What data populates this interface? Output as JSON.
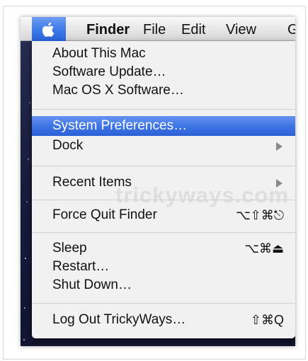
{
  "menubar": {
    "apple_icon": "apple-logo-icon",
    "items": [
      "Finder",
      "File",
      "Edit",
      "View",
      "G"
    ]
  },
  "watermark": "trickyways.com",
  "menu": {
    "groups": [
      [
        {
          "label": "About This Mac"
        },
        {
          "label": "Software Update…"
        },
        {
          "label": "Mac OS X Software…"
        }
      ],
      [
        {
          "label": "System Preferences…",
          "highlighted": true
        },
        {
          "label": "Dock",
          "submenu": true
        }
      ],
      [
        {
          "label": "Recent Items",
          "submenu": true
        }
      ],
      [
        {
          "label": "Force Quit Finder",
          "shortcut": "⌥⇧⌘⎋"
        }
      ],
      [
        {
          "label": "Sleep",
          "shortcut": "⌥⌘⏏"
        },
        {
          "label": "Restart…"
        },
        {
          "label": "Shut Down…"
        }
      ],
      [
        {
          "label": "Log Out TrickyWays…",
          "shortcut": "⇧⌘Q"
        }
      ]
    ]
  },
  "colors": {
    "highlight": "#3c73e4",
    "apple_tab": "#3f7be8",
    "desktop": "#1f2345"
  }
}
